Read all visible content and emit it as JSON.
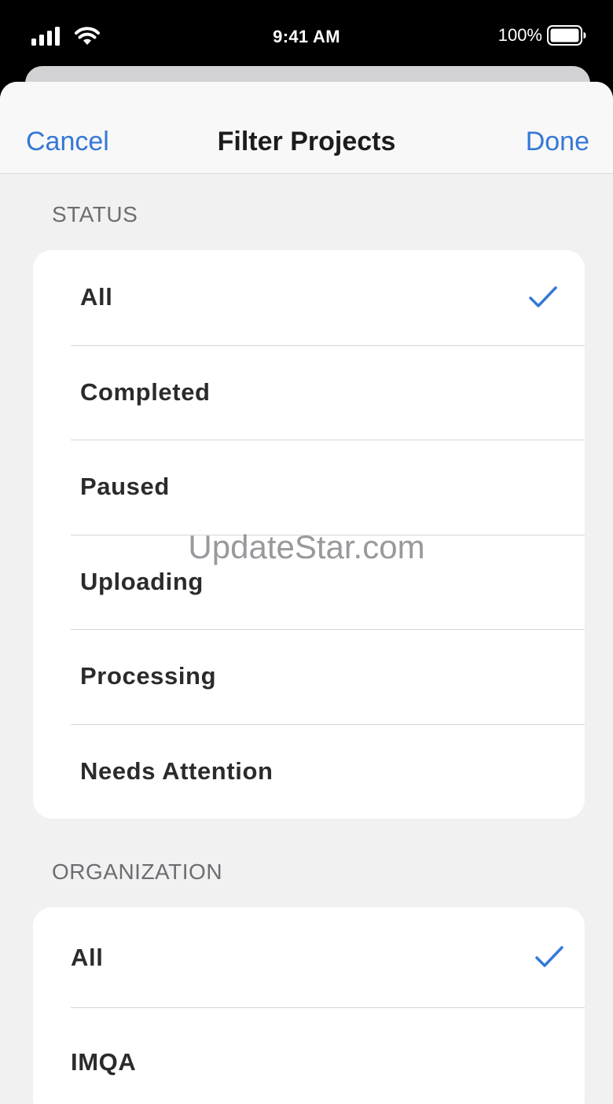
{
  "status_bar": {
    "time": "9:41 AM",
    "battery_percent": "100%",
    "icons": [
      "signal-icon",
      "wifi-icon",
      "battery-icon"
    ]
  },
  "nav": {
    "cancel_label": "Cancel",
    "title": "Filter Projects",
    "done_label": "Done"
  },
  "status_section": {
    "header": "STATUS",
    "options": [
      {
        "label": "All",
        "selected": true
      },
      {
        "label": "Completed",
        "selected": false
      },
      {
        "label": "Paused",
        "selected": false
      },
      {
        "label": "Uploading",
        "selected": false
      },
      {
        "label": "Processing",
        "selected": false
      },
      {
        "label": "Needs Attention",
        "selected": false
      }
    ]
  },
  "organization_section": {
    "header": "ORGANIZATION",
    "options": [
      {
        "label": "All",
        "selected": true
      },
      {
        "label": "IMQA",
        "selected": false
      }
    ]
  },
  "watermark": "UpdateStar.com",
  "colors": {
    "accent": "#3478d8",
    "sheet_background": "#f1f1f1",
    "group_background": "#ffffff",
    "label_text": "#2b2b2d",
    "section_header_text": "#6d6d72"
  }
}
